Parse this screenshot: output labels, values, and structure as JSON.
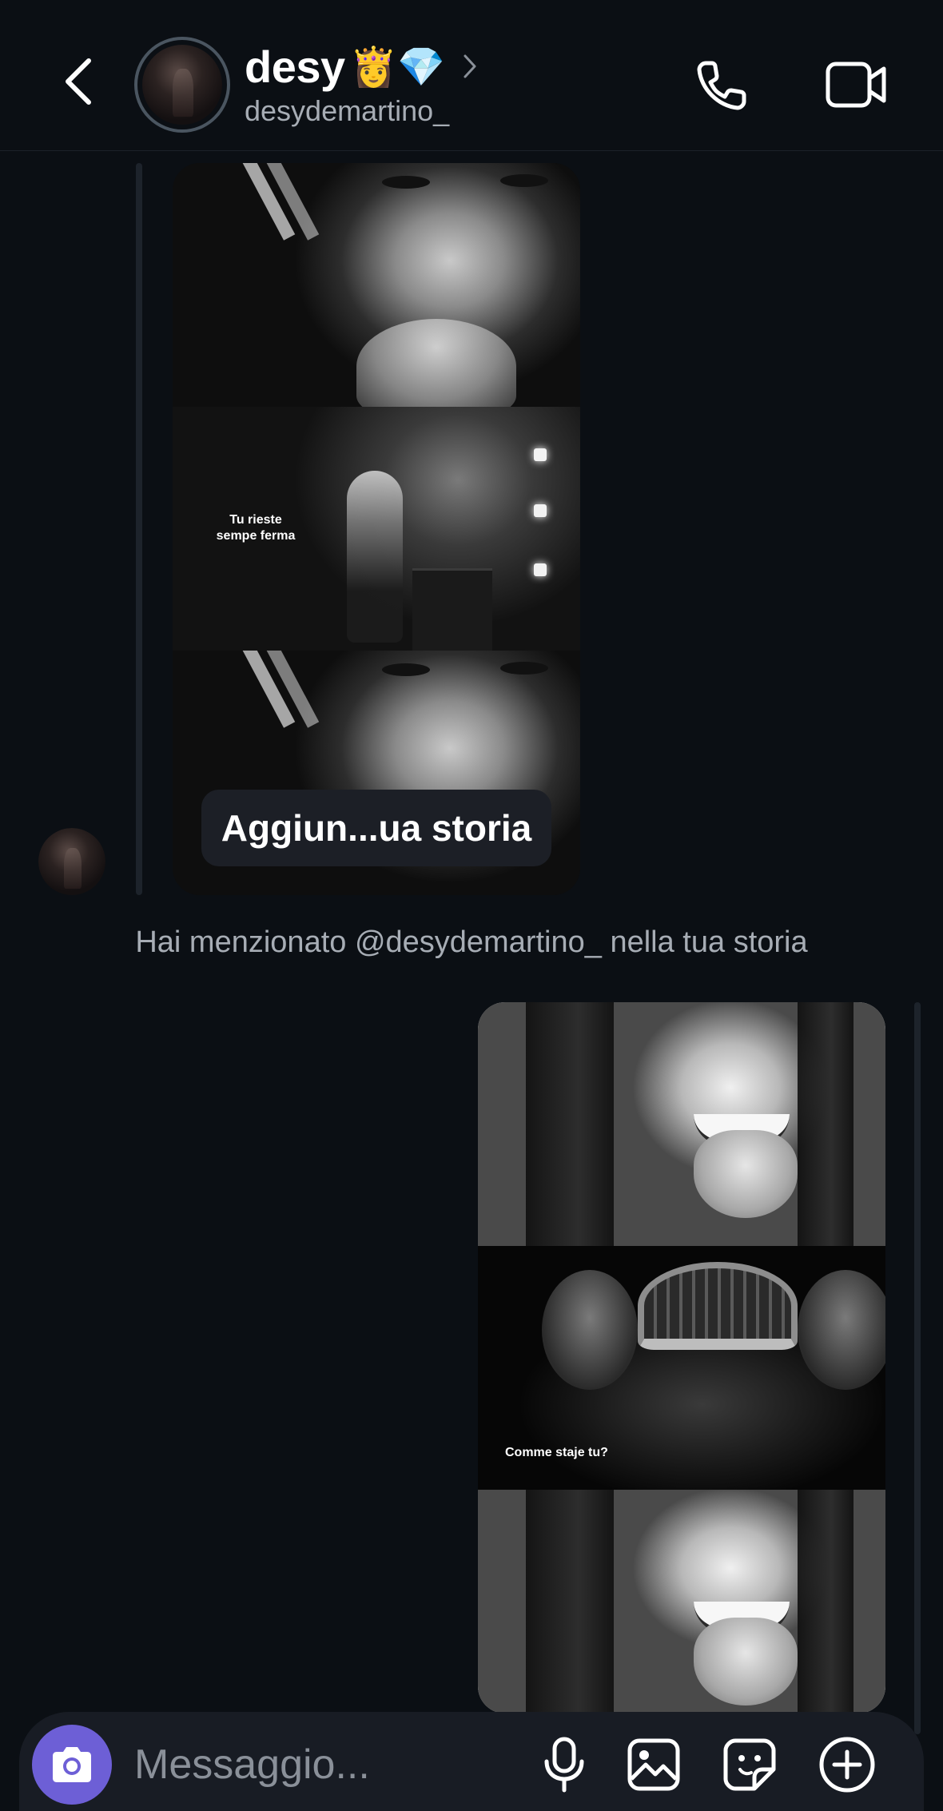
{
  "header": {
    "name": "desy",
    "emoji": "👸💎",
    "username": "desydemartino_",
    "icons": {
      "back": "chevron-left-icon",
      "chevron": "chevron-right-icon",
      "call": "phone-icon",
      "video": "video-camera-icon"
    }
  },
  "thread": {
    "received_story": {
      "caption": "Tu rieste\nsempe ferma",
      "add_story_label": "Aggiun...ua storia"
    },
    "mention_note": "Hai menzionato @desydemartino_ nella tua storia",
    "sent_story": {
      "caption": "Comme staje tu?"
    }
  },
  "composer": {
    "placeholder": "Messaggio...",
    "icons": {
      "camera": "camera-icon",
      "mic": "microphone-icon",
      "gallery": "image-icon",
      "sticker": "sticker-icon",
      "plus": "plus-circle-icon"
    }
  },
  "colors": {
    "background": "#0b0f14",
    "camera_button": "#6d5fd6",
    "secondary_text": "#a7adb5",
    "composer_bg": "#181c24"
  }
}
